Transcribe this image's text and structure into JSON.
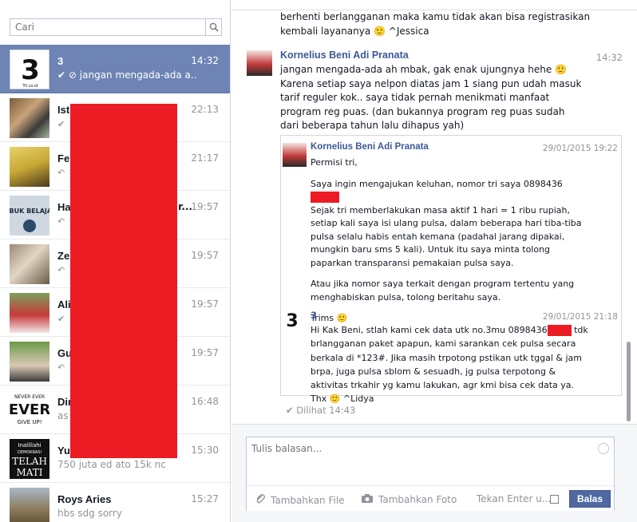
{
  "search": {
    "placeholder": "Cari"
  },
  "conversations": [
    {
      "name": "3",
      "time": "14:32",
      "preview": "jangan mengada-ada a...",
      "active": true
    },
    {
      "name": "Ist",
      "time": "22:13",
      "preview": ""
    },
    {
      "name": "Fe",
      "time": "21:17",
      "preview": ""
    },
    {
      "name": "Ha",
      "time": "19:57",
      "preview": ""
    },
    {
      "name": "Ze",
      "time": "19:57",
      "preview": ""
    },
    {
      "name": "Ali",
      "time": "19:57",
      "preview": ""
    },
    {
      "name": "Gu",
      "time": "19:57",
      "preview": ""
    },
    {
      "name": "Dir",
      "time": "16:48",
      "preview": "as"
    },
    {
      "name": "Yu",
      "time": "15:30",
      "preview": "750 juta ed ato 15k nc"
    },
    {
      "name": "Roys Aries",
      "time": "15:27",
      "preview": "hbs sdg sorry"
    }
  ],
  "avatar_texts": {
    "brand_three": "3",
    "brand_sub": "Tri.co.id",
    "sebuk_belajar": "SIBUK BELAJAR",
    "never_ever": "NEVER EVER",
    "ever": "EVER",
    "give_up": "GIVE UP!",
    "inalillahi": "Inalillahi",
    "demokrasi": "DEMOKRASI",
    "telah": "TELAH",
    "mati": "MATI"
  },
  "thread": {
    "msg1_line1": "berhenti berlangganan maka kamu tidak akan bisa registrasikan",
    "msg1_line2": "kembali layananya 🙂 ^Jessica",
    "sender": "Kornelius Beni Adi Pranata",
    "sender_time": "14:32",
    "msg2": "jangan mengada-ada ah mbak, gak enak ujungnya hehe 🙂 Karena setiap saya nelpon diatas jam 1 siang pun udah masuk tarif reguler kok.. saya tidak pernah menikmati manfaat program reg puas. (dan bukannya program reg puas sudah dari beberapa tahun lalu dihapus yah)",
    "quote": {
      "name": "Kornelius Beni Adi Pranata",
      "time": "29/01/2015 19:22",
      "greeting": "Permisi tri,",
      "p1_prefix": "Saya ingin mengajukan keluhan, nomor tri saya 0898436",
      "p1_rest": "Sejak tri memberlakukan masa aktif 1 hari = 1 ribu rupiah, setiap kali saya isi ulang pulsa, dalam beberapa hari tiba-tiba pulsa selalu habis entah kemana (padahal jarang dipakai, mungkin baru sms 5 kali). Untuk itu saya minta tolong paparkan transparansi pemakaian pulsa saya.",
      "p2": "Atau jika nomor saya terkait dengan program tertentu yang menghabiskan pulsa, tolong beritahu saya.",
      "p3": "Trims 🙂",
      "reply_name": "3",
      "reply_time": "29/01/2015 21:18",
      "reply_prefix": "Hi Kak Beni, stlah kami cek data utk no.3mu 0898436",
      "reply_suffix": " tdk",
      "reply_rest": "brlangganan paket apapun, kami sarankan cek pulsa secara berkala di *123#. Jika masih trpotong pstikan utk tggal & jam brpa, juga pulsa sblom & sesuadh, jg pulsa terpotong & aktivitas trkahir yg kamu lakukan, agr kmi bisa cek data ya. Thx 🙂 ^Lidya"
    },
    "seen": "Dilihat 14:43"
  },
  "composer": {
    "placeholder": "Tulis balasan...",
    "add_file": "Tambahkan File",
    "add_photo": "Tambahkan Foto",
    "enter_hint": "Tekan Enter u...",
    "send": "Balas"
  }
}
